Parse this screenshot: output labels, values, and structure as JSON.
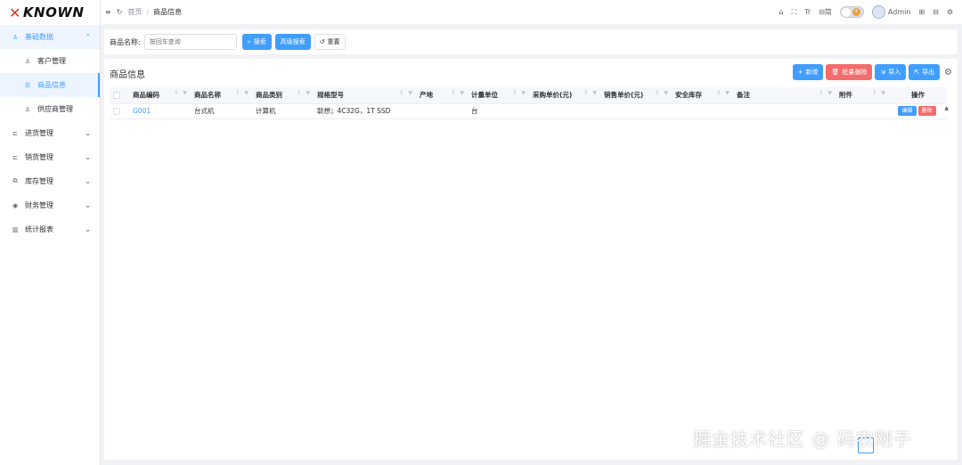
{
  "brand": {
    "logo_text": "KNOWN"
  },
  "sidebar": {
    "groups": [
      {
        "label": "基础数据",
        "icon": "user-icon",
        "expanded": true,
        "items": [
          {
            "label": "客户管理",
            "icon": "user-group-icon"
          },
          {
            "label": "商品信息",
            "icon": "list-icon",
            "active": true
          },
          {
            "label": "供应商管理",
            "icon": "supplier-icon"
          }
        ]
      },
      {
        "label": "进货管理",
        "icon": "import-icon"
      },
      {
        "label": "销货管理",
        "icon": "export-icon"
      },
      {
        "label": "库存管理",
        "icon": "stock-icon"
      },
      {
        "label": "财务管理",
        "icon": "finance-icon"
      },
      {
        "label": "统计报表",
        "icon": "chart-icon"
      }
    ]
  },
  "header": {
    "breadcrumb": [
      "首页",
      "商品信息"
    ],
    "right": {
      "lang_label": "Tr",
      "simplified_label": "简",
      "user": "Admin"
    }
  },
  "search": {
    "label": "商品名称:",
    "placeholder": "按回车查询",
    "search_btn": "搜索",
    "advanced_btn": "高级搜索",
    "reset_btn": "重置"
  },
  "panel": {
    "title": "商品信息",
    "add_btn": "新增",
    "batch_delete_btn": "批量删除",
    "import_btn": "导入",
    "export_btn": "导出"
  },
  "table": {
    "headers": [
      "商品编码",
      "商品名称",
      "商品类别",
      "规格型号",
      "产地",
      "计量单位",
      "采购单价(元)",
      "销售单价(元)",
      "安全库存",
      "备注",
      "附件",
      "操作"
    ],
    "rows": [
      {
        "code": "G001",
        "name": "台式机",
        "category": "计算机",
        "spec": "联想；4C32G，1T SSD",
        "origin": "",
        "unit": "台",
        "purchase_price": "",
        "sale_price": "",
        "safety_stock": "",
        "remark": "",
        "attachment": "",
        "edit": "编辑",
        "delete": "删除"
      }
    ]
  },
  "watermark": "掘金技术社区 @ 码农刚子",
  "colors": {
    "primary": "#409eff",
    "danger": "#f56c6c"
  }
}
